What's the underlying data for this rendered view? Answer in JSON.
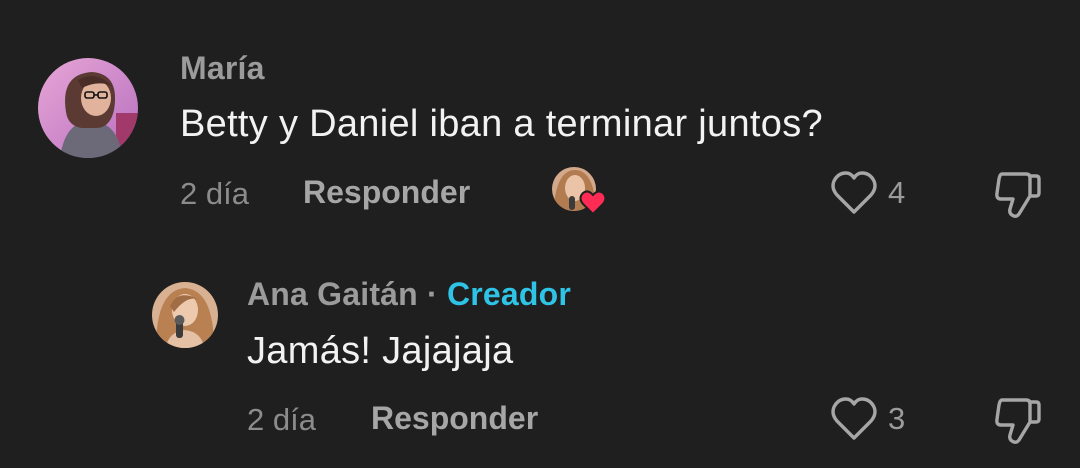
{
  "comments": [
    {
      "author": "María",
      "text": "Betty y Daniel iban a terminar juntos?",
      "time": "2 día",
      "reply_label": "Responder",
      "likes": "4",
      "creator_liked": true
    },
    {
      "author": "Ana Gaitán",
      "separator": "·",
      "badge": "Creador",
      "text": "Jamás! Jajajaja",
      "time": "2 día",
      "reply_label": "Responder",
      "likes": "3"
    }
  ],
  "colors": {
    "background": "#1f1f1f",
    "creator_badge": "#2fc3e6",
    "heart_badge": "#fe2c55"
  },
  "icons": {
    "like": "heart-outline-icon",
    "dislike": "thumbs-down-icon",
    "creator_like": "creator-heart-badge"
  }
}
